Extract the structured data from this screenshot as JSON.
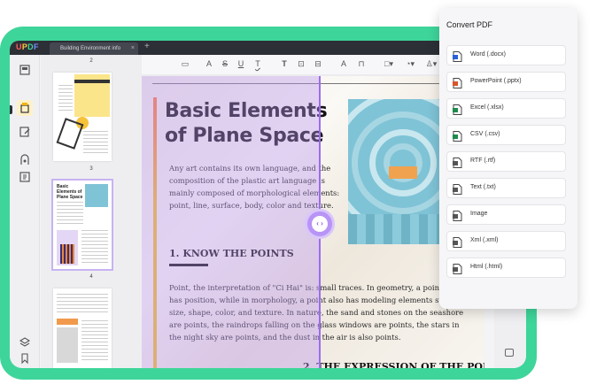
{
  "app": {
    "logo": "UPDF",
    "logo_colors": [
      "#ff5a5f",
      "#ffcc3d",
      "#3ed59a",
      "#7a8cff"
    ]
  },
  "tabs": [
    {
      "label": "Building Environment info",
      "close": "×"
    }
  ],
  "tab_add": "+",
  "toolbar": {
    "tools": [
      "comment",
      "highlight",
      "strikethrough",
      "underline",
      "squiggly",
      "text",
      "textbox",
      "text-callout",
      "pencil",
      "eraser",
      "shape",
      "stamp",
      "signature"
    ],
    "glyphs": [
      "▭",
      "A",
      "S",
      "U",
      "T",
      "T",
      "⊡",
      "⊟",
      "A",
      "⊓",
      "□▾",
      "◔▾",
      "♙▾"
    ]
  },
  "thumbnails": {
    "page_numbers": [
      "2",
      "3",
      "4"
    ]
  },
  "document": {
    "title": "Basic Elements of Plane Space",
    "intro": "Any art contains its own language, and the composition of the plastic art language is mainly composed of morphological elements: point, line, surface, body, color and texture.",
    "section1_heading": "1. KNOW THE POINTS",
    "section1_body": "Point, the interpretation of \"Ci Hai\" is: small traces. In geometry, a point only has position, while in morphology, a point also has modeling elements such as size, shape, color, and texture. In nature, the sand and stones on the seashore are points, the raindrops falling on the glass windows are points, the stars in the night sky are points, and the dust in the air is also points.",
    "section2_heading": "2. THE EXPRESSION OF THE POI"
  },
  "compare_handle": {
    "label": "‹ ›"
  },
  "convert_panel": {
    "title": "Convert PDF",
    "items": [
      {
        "label": "Word (.docx)",
        "icon": "word-icon"
      },
      {
        "label": "PowerPoint (.pptx)",
        "icon": "powerpoint-icon"
      },
      {
        "label": "Excel (.xlsx)",
        "icon": "excel-icon"
      },
      {
        "label": "CSV (.csv)",
        "icon": "csv-icon"
      },
      {
        "label": "RTF (.rtf)",
        "icon": "rtf-icon"
      },
      {
        "label": "Text (.txt)",
        "icon": "text-icon"
      },
      {
        "label": "Image",
        "icon": "image-icon"
      },
      {
        "label": "Xml (.xml)",
        "icon": "xml-icon"
      },
      {
        "label": "Html (.html)",
        "icon": "html-icon"
      }
    ]
  },
  "colors": {
    "frame": "#3ed59a",
    "accent_purple": "#9b6cf0",
    "titlebar": "#2c2f36"
  }
}
